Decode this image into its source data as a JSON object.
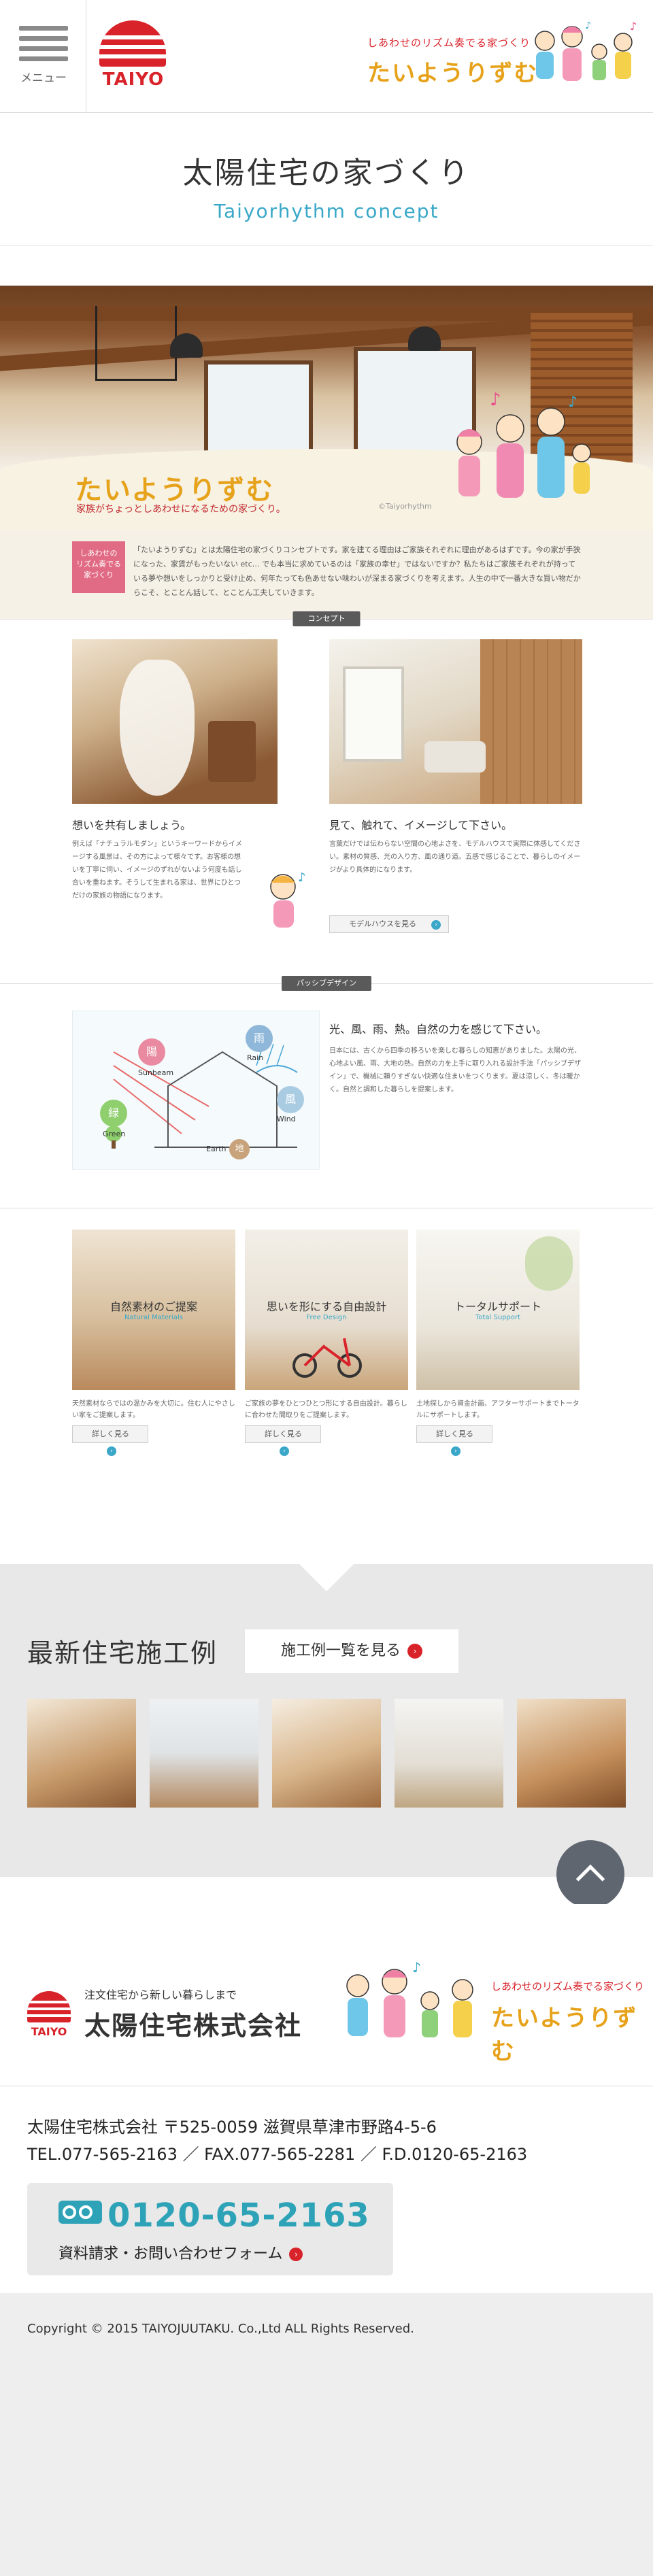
{
  "header": {
    "menu_label": "メニュー",
    "logo_text": "TAIYO",
    "brand_tagline": "しあわせのリズム奏でる家づくり",
    "brand_name": "たいようりずむ"
  },
  "title": {
    "main": "太陽住宅の家づくり",
    "sub": "Taiyorhythm concept"
  },
  "hero": {
    "logo": "たいようりずむ",
    "tagline": "家族がちょっとしあわせになるための家づくり。",
    "small": "©Taiyorhythm"
  },
  "intro": {
    "badge": "しあわせの リズム奏でる 家づくり",
    "text": "「たいようりずむ」とは太陽住宅の家づくりコンセプトです。家を建てる理由はご家族それぞれに理由があるはずです。今の家が手狭になった、家賃がもったいない etc… でも本当に求めているのは「家族の幸せ」ではないですか？私たちはご家族それぞれが持っている夢や想いをしっかりと受け止め、何年たっても色あせない味わいが深まる家づくりを考えます。人生の中で一番大きな買い物だからこそ、とことん話して、とことん工夫していきます。"
  },
  "concept": {
    "tag": "コンセプト",
    "left": {
      "title": "想いを共有しましょう。",
      "text": "例えば「ナチュラルモダン」というキーワードからイメージする風景は、その方によって様々です。お客様の想いを丁寧に伺い、イメージのずれがないよう何度も話し合いを重ねます。そうして生まれる家は、世界にひとつだけの家族の物語になります。"
    },
    "right": {
      "title": "見て、触れて、イメージして下さい。",
      "text": "言葉だけでは伝わらない空間の心地よさを、モデルハウスで実際に体感してください。素材の質感、光の入り方、風の通り道。五感で感じることで、暮らしのイメージがより具体的になります。",
      "button": "モデルハウスを見る"
    }
  },
  "passive": {
    "tag": "パッシブデザイン",
    "title": "光、風、雨、熱。自然の力を感じて下さい。",
    "text": "日本には、古くから四季の移ろいを楽しむ暮らしの知恵がありました。太陽の光、心地よい風、雨、大地の熱。自然の力を上手に取り入れる設計手法「パッシブデザイン」で、機械に頼りすぎない快適な住まいをつくります。夏は涼しく、冬は暖かく。自然と調和した暮らしを提案します。",
    "diagram": {
      "labels": {
        "sun_kanji": "陽",
        "sun": "Sunbeam",
        "rain_kanji": "雨",
        "rain": "Rain",
        "wind_kanji": "風",
        "wind": "Wind",
        "green_kanji": "緑",
        "green": "Green",
        "earth_kanji": "地",
        "earth": "Earth"
      }
    }
  },
  "cards": [
    {
      "title": "自然素材のご提案",
      "sub": "Natural Materials",
      "text": "天然素材ならではの温かみを大切に。住む人にやさしい家をご提案します。",
      "button": "詳しく見る"
    },
    {
      "title": "思いを形にする自由設計",
      "sub": "Free Design",
      "text": "ご家族の夢をひとつひとつ形にする自由設計。暮らしに合わせた間取りをご提案します。",
      "button": "詳しく見る"
    },
    {
      "title": "トータルサポート",
      "sub": "Total Support",
      "text": "土地探しから資金計画、アフターサポートまでトータルにサポートします。",
      "button": "詳しく見る"
    }
  ],
  "works": {
    "title": "最新住宅施工例",
    "button": "施工例一覧を見る"
  },
  "footer": {
    "tag": "注文住宅から新しい暮らしまで",
    "company": "太陽住宅株式会社",
    "logo_text": "TAIYO",
    "brand_tagline": "しあわせのリズム奏でる家づくり",
    "brand_name": "たいようりずむ",
    "address": "太陽住宅株式会社 〒525-0059 滋賀県草津市野路4-5-6",
    "contact": "TEL.077-565-2163 ／ FAX.077-565-2281 ／ F.D.0120-65-2163",
    "phone": "0120-65-2163",
    "form_link": "資料請求・お問い合わせフォーム",
    "copyright": "Copyright © 2015 TAIYOJUUTAKU. Co.,Ltd ALL Rights Reserved."
  },
  "colors": {
    "brand_red": "#d9232a",
    "accent_blue": "#39a8c8",
    "brand_orange": "#e7a21b"
  }
}
